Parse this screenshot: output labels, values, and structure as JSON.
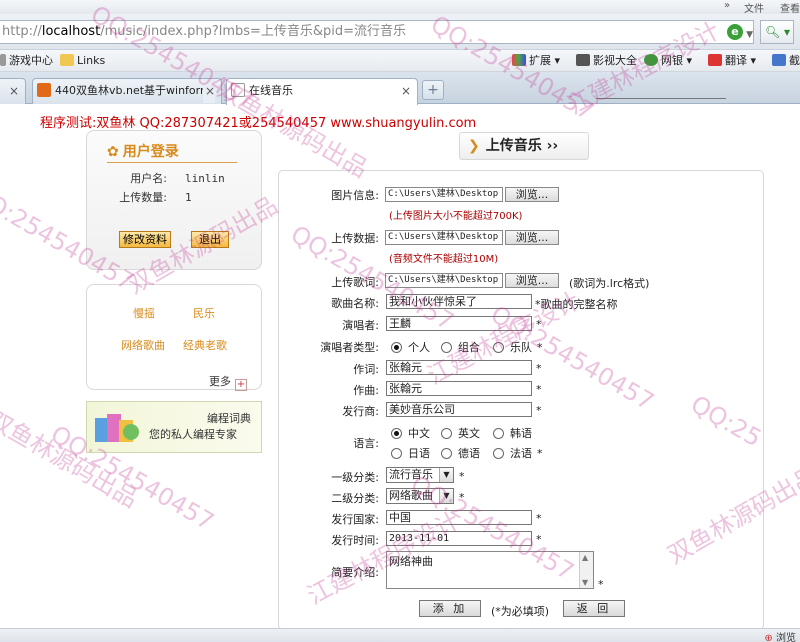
{
  "browser": {
    "menu": {
      "file": "文件",
      "view": "查看"
    },
    "url": {
      "prefix": "http://",
      "host": "localhost",
      "path": "/music/index.php?lmbs=上传音乐&pid=流行音乐"
    },
    "favorites": [
      {
        "label": "游戏中心"
      },
      {
        "label": "Links"
      },
      {
        "label": "扩展"
      },
      {
        "label": "影视大全"
      },
      {
        "label": "网银"
      },
      {
        "label": "翻译"
      },
      {
        "label": "截"
      }
    ],
    "tabs": [
      {
        "label": ""
      },
      {
        "label": "440双鱼林vb.net基于winform"
      },
      {
        "label": "在线音乐"
      }
    ],
    "status": "浏览"
  },
  "page": {
    "headline": "程序测试:双鱼林 QQ:287307421或254540457 www.shuangyulin.com",
    "login": {
      "title": "用户登录",
      "username_label": "用户名:",
      "username": "linlin",
      "upload_count_label": "上传数量:",
      "upload_count": "1",
      "edit_button": "修改资料",
      "logout_button": "退出"
    },
    "categories": [
      "慢摇",
      "民乐",
      "网络歌曲",
      "经典老歌"
    ],
    "more": "更多",
    "banner": {
      "title": "编程词典",
      "subtitle": "您的私人编程专家"
    },
    "section_title": "上传音乐",
    "form": {
      "image_label": "图片信息:",
      "image_path": "C:\\Users\\建林\\Desktop",
      "image_hint": "(上传图片大小不能超过700K)",
      "data_label": "上传数据:",
      "data_path": "C:\\Users\\建林\\Desktop",
      "data_hint": "(音频文件不能超过10M)",
      "lyric_label": "上传歌词:",
      "lyric_path": "C:\\Users\\建林\\Desktop",
      "lyric_note": "(歌词为.lrc格式)",
      "browse_label": "浏览...",
      "song_name_label": "歌曲名称:",
      "song_name": "我和小伙伴惊呆了",
      "song_name_note": "*歌曲的完整名称",
      "singer_label": "演唱者:",
      "singer": "王麟",
      "singer_type_label": "演唱者类型:",
      "singer_types": [
        "个人",
        "组合",
        "乐队"
      ],
      "lyricist_label": "作词:",
      "lyricist": "张翰元",
      "composer_label": "作曲:",
      "composer": "张翰元",
      "publisher_label": "发行商:",
      "publisher": "美妙音乐公司",
      "language_label": "语言:",
      "languages": [
        "中文",
        "英文",
        "韩语",
        "日语",
        "德语",
        "法语"
      ],
      "level1_label": "一级分类:",
      "level1": "流行音乐",
      "level2_label": "二级分类:",
      "level2": "网络歌曲",
      "country_label": "发行国家:",
      "country": "中国",
      "date_label": "发行时间:",
      "date": "2013-11-01",
      "intro_label": "简要介绍:",
      "intro": "网络神曲",
      "star": "*",
      "add_button": "添 加",
      "required_note": "(*为必填项)",
      "back_button": "返 回"
    },
    "watermarks": {
      "a": "双鱼林源码出品",
      "b": "江建林程序设计",
      "c": "QQ:254540457",
      "d": "QQ:25"
    }
  }
}
